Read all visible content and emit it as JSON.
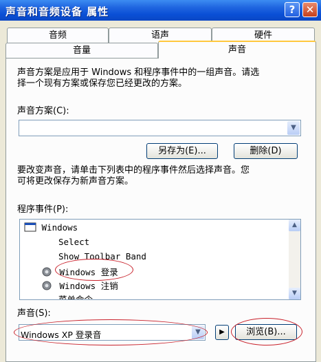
{
  "window": {
    "title": "声音和音频设备 属性",
    "help_label": "?",
    "close_label": "✕"
  },
  "tabs": {
    "row_back": [
      "音频",
      "语声",
      "硬件"
    ],
    "row_front": [
      "音量",
      "声音"
    ],
    "active": "声音"
  },
  "intro": {
    "line1": "声音方案是应用于 Windows 和程序事件中的一组声音。请选",
    "line2": "择一个现有方案或保存您已经更改的方案。"
  },
  "scheme": {
    "label": "声音方案(C):",
    "value": "",
    "save_as_label": "另存为(E)...",
    "delete_label": "删除(D)"
  },
  "change": {
    "line1": "要改变声音，请单击下列表中的程序事件然后选择声音。您",
    "line2": "可将更改保存为新声音方案。"
  },
  "events": {
    "label": "程序事件(P):",
    "items": [
      {
        "text": "Windows",
        "icon": "window-icon"
      },
      {
        "text": "Select",
        "icon": ""
      },
      {
        "text": "Show Toolbar Band",
        "icon": ""
      },
      {
        "text": "Windows 登录",
        "icon": "speaker-icon"
      },
      {
        "text": "Windows 注销",
        "icon": "speaker-icon"
      },
      {
        "text": "菜单命令",
        "icon": ""
      }
    ]
  },
  "sound": {
    "label": "声音(S):",
    "value": "Windows XP 登录音",
    "play_label": "▶",
    "browse_label": "浏览(B)..."
  },
  "colors": {
    "annotation": "#c8202a",
    "titlebar": "#0a4fd6",
    "active_tab_accent": "#ffc83c"
  }
}
